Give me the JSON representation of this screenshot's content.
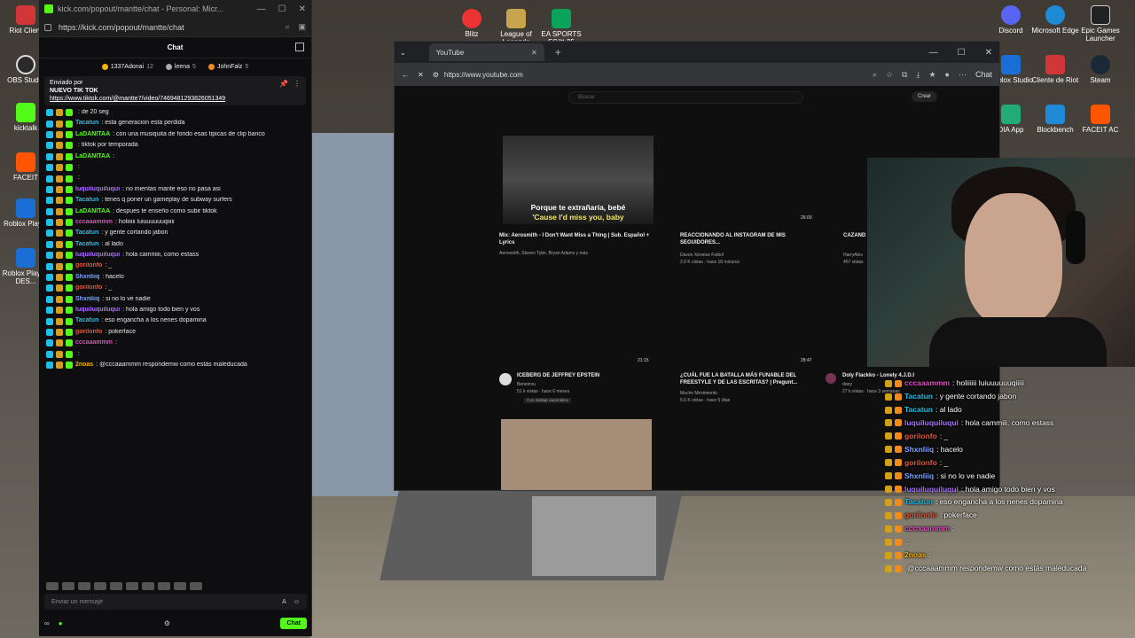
{
  "desktop": {
    "left_icons": [
      {
        "label": "Riot Client",
        "color": "#d13639"
      },
      {
        "label": "OBS Studio",
        "color": "#2a2a2a"
      },
      {
        "label": "kicktalk",
        "color": "#53fc18"
      },
      {
        "label": "FACEIT",
        "color": "#ff5500"
      },
      {
        "label": "Roblox Player",
        "color": "#1a6fd6"
      },
      {
        "label": "Roblox Player-DES...",
        "color": "#1a6fd6"
      }
    ],
    "top_icons": [
      {
        "label": "Blitz",
        "color": "#e33"
      },
      {
        "label": "League of Legends",
        "color": "#c8a44c"
      },
      {
        "label": "EA SPORTS FC™ 25",
        "color": "#0aa35a"
      }
    ],
    "right_icons": [
      {
        "label": "Discord",
        "color": "#5865f2"
      },
      {
        "label": "Microsoft Edge",
        "color": "#1f8ad6"
      },
      {
        "label": "Epic Games Launcher",
        "color": "#222"
      },
      {
        "label": "Roblox Studio",
        "color": "#1a6fd6"
      },
      {
        "label": "Cliente de Riot",
        "color": "#d13639"
      },
      {
        "label": "Steam",
        "color": "#1b2838"
      },
      {
        "label": "DIA App",
        "color": "#2a7"
      },
      {
        "label": "Blockbench",
        "color": "#1f8ad6"
      },
      {
        "label": "FACEIT AC",
        "color": "#ff5500"
      }
    ]
  },
  "chat_window": {
    "title": "kick.com/popout/mantte/chat - Personal: Micr...",
    "url": "https://kick.com/popout/mantte/chat",
    "header": "Chat",
    "gifters": [
      {
        "name": "1337Adonai",
        "count": "12",
        "color": "#f5b300"
      },
      {
        "name": "leena",
        "count": "5",
        "color": "#aaa"
      },
      {
        "name": "JohnFalz",
        "count": "5",
        "color": "#f08a1a"
      }
    ],
    "pinned": {
      "by": "Enviado por",
      "title": "NUEVO TIK TOK",
      "link": "https://www.tiktok.com/@mantte7/video/7469481293826051349"
    },
    "messages": [
      {
        "user": "",
        "text": ": de 20 seg",
        "ucolor": "#53fc18"
      },
      {
        "user": "Tacatun",
        "text": ": esta generacion esta perdida",
        "ucolor": "#20c0e8"
      },
      {
        "user": "LaDANITAA",
        "text": ": con una musiquita de fondo esas tipicas de clip banco",
        "ucolor": "#53fc18"
      },
      {
        "user": "",
        "text": ": tiktok por temporada",
        "ucolor": "#53fc18"
      },
      {
        "user": "LaDANITAA",
        "text": ":",
        "ucolor": "#53fc18"
      },
      {
        "user": "",
        "text": ":",
        "ucolor": "#53fc18"
      },
      {
        "user": "",
        "text": ":",
        "ucolor": "#53fc18"
      },
      {
        "user": "luquiluquiluqui",
        "text": ": no mientas mante eso no pasa asi",
        "ucolor": "#a970ff"
      },
      {
        "user": "Tacatun",
        "text": ": tenes q poner un gameplay de subway surfers",
        "ucolor": "#20c0e8"
      },
      {
        "user": "LaDANITAA",
        "text": ": despues te enseño como subir tiktok",
        "ucolor": "#53fc18"
      },
      {
        "user": "cccaaammm",
        "text": ": holiiiiii luiuuuuuuqiiiii",
        "ucolor": "#e34bc3"
      },
      {
        "user": "Tacatun",
        "text": ": y gente cortando jabon",
        "ucolor": "#20c0e8"
      },
      {
        "user": "Tacatun",
        "text": ": al lado",
        "ucolor": "#20c0e8"
      },
      {
        "user": "luquiluquiluqui",
        "text": ": hola cammiii, como estass",
        "ucolor": "#a970ff"
      },
      {
        "user": "gorilonfo",
        "text": ": _",
        "ucolor": "#e0593b"
      },
      {
        "user": "Shxnliiq",
        "text": ": hacelo",
        "ucolor": "#7ea3ff"
      },
      {
        "user": "gorilonfo",
        "text": ": _",
        "ucolor": "#e0593b"
      },
      {
        "user": "Shxnliiq",
        "text": ": si no lo ve nadie",
        "ucolor": "#7ea3ff"
      },
      {
        "user": "luquiluquiluqui",
        "text": ": hola amigo todo bien y vos",
        "ucolor": "#a970ff"
      },
      {
        "user": "Tacatun",
        "text": ": eso engancha a los nenes dopamina",
        "ucolor": "#20c0e8"
      },
      {
        "user": "gorilonfo",
        "text": ": pokerface",
        "ucolor": "#e0593b"
      },
      {
        "user": "cccaaammm",
        "text": ":",
        "ucolor": "#e34bc3"
      },
      {
        "user": "",
        "text": ":",
        "ucolor": "#53fc18"
      },
      {
        "user": "2noas",
        "text": ": @cccaaammm respondemw como estás maleducada",
        "ucolor": "#f5b300"
      }
    ],
    "input_placeholder": "Enviar un mensaje",
    "send_label": "Chat"
  },
  "browser": {
    "tab_title": "YouTube",
    "url": "https://www.youtube.com",
    "chat_pill": "Chat",
    "search_placeholder": "Buscar",
    "create_label": "Crear",
    "videos": [
      {
        "title": "Mix: Aerosmith - I Don't Want Miss a Thing | Sub. Español + Lyrics",
        "meta": "Aerosmith, Steven Tyler, Bryan Adams y más",
        "caption1": "Porque te extrañaría, bebé",
        "caption2": "'Cause I'd miss you, baby"
      },
      {
        "title": "REACCIONANDO AL INSTAGRAM DE MIS SEGUIDORES...",
        "meta": "Davoo Xeneize Futbol",
        "meta2": "2.9 K vistas · hace 18 minutos",
        "duration": "26:00"
      },
      {
        "title": "CAZAND",
        "meta": "HarryAlex",
        "meta2": "457 vistas"
      },
      {
        "title": "ICEBERG DE JEFFREY EPSTEIN",
        "meta": "Beneinvu",
        "meta2": "51 k vistas · hace 6 meses",
        "meta3": "Con doblaje automático",
        "duration": "21:15"
      },
      {
        "title": "¿CUÁL FUE LA BATALLA MÁS FUNABLE DEL FREESTYLE Y DE LAS ESCRITAS? | Pregunt...",
        "meta": "Mucho Movimiento",
        "meta2": "5.6 K vistas · hace 5 días",
        "duration": "28:47"
      },
      {
        "title": "Doly Flackko - Lonely 4.J.D.I",
        "meta": "doey",
        "meta2": "27 k vistas · hace 3 semanas"
      }
    ]
  },
  "overlay_chat": [
    {
      "user": "cccaaammm",
      "text": ": holiiiiii luiuuuuuuqiiiii",
      "ucolor": "#e34bc3"
    },
    {
      "user": "Tacatun",
      "text": ": y gente cortando jabon",
      "ucolor": "#20c0e8"
    },
    {
      "user": "Tacatun",
      "text": ": al lado",
      "ucolor": "#20c0e8"
    },
    {
      "user": "luquiluquiluqui",
      "text": ": hola cammiii, como estass",
      "ucolor": "#a970ff"
    },
    {
      "user": "gorilonfo",
      "text": ": _",
      "ucolor": "#e0593b"
    },
    {
      "user": "Shxnliiq",
      "text": ": hacelo",
      "ucolor": "#7ea3ff"
    },
    {
      "user": "gorilonfo",
      "text": ": _",
      "ucolor": "#e0593b"
    },
    {
      "user": "Shxnliiq",
      "text": ": si no lo ve nadie",
      "ucolor": "#7ea3ff"
    },
    {
      "user": "luquiluquiluqui",
      "text": ": hola amigo todo bien y vos",
      "ucolor": "#a970ff"
    },
    {
      "user": "Tacatun",
      "text": ": eso engancha a los nenes dopamina",
      "ucolor": "#20c0e8"
    },
    {
      "user": "gorilonfo",
      "text": ": pokerface",
      "ucolor": "#e0593b"
    },
    {
      "user": "cccaaammm",
      "text": ":",
      "ucolor": "#e34bc3"
    },
    {
      "user": "",
      "text": ":",
      "ucolor": "#53fc18"
    },
    {
      "user": "2noas",
      "text": ":",
      "ucolor": "#f5b300"
    },
    {
      "user": "",
      "text": "@cccaaammm respondemw como estás maleducada",
      "ucolor": "#fff"
    }
  ]
}
